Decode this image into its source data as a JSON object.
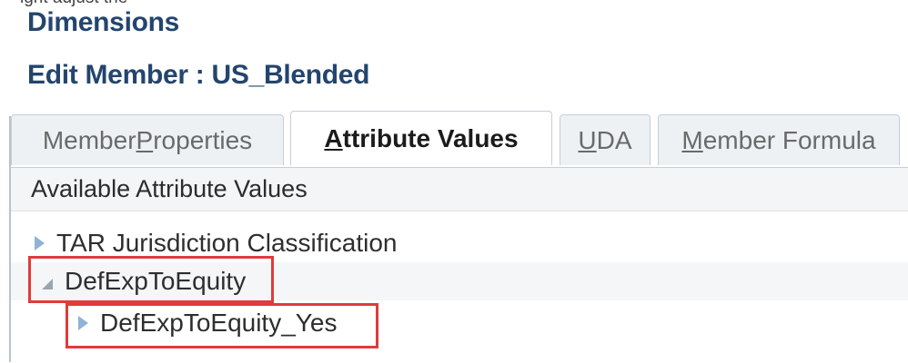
{
  "header": {
    "top_clipped_text": "ight adjust the "
  },
  "page_title": "Dimensions",
  "edit_title": "Edit Member : US_Blended",
  "tabs": [
    {
      "pre": "Member ",
      "u": "P",
      "post": "roperties",
      "active": false
    },
    {
      "pre": "",
      "u": "A",
      "post": "ttribute Values",
      "active": true
    },
    {
      "pre": "",
      "u": "U",
      "post": "DA",
      "active": false
    },
    {
      "pre": "",
      "u": "M",
      "post": "ember Formula",
      "active": false
    }
  ],
  "panel": {
    "header": "Available Attribute Values",
    "rows": [
      {
        "label": "TAR Jurisdiction Classification",
        "expanded": false,
        "level": 0
      },
      {
        "label": "DefExpToEquity",
        "expanded": true,
        "level": 0
      },
      {
        "label": "DefExpToEquity_Yes",
        "expanded": false,
        "level": 1
      }
    ]
  },
  "colors": {
    "title": "#23456e",
    "highlight": "#e03b3b",
    "expand_icon": "#8fb3d5"
  },
  "icons": {
    "collapsed": "triangle-right-icon",
    "expanded": "triangle-down-icon"
  }
}
